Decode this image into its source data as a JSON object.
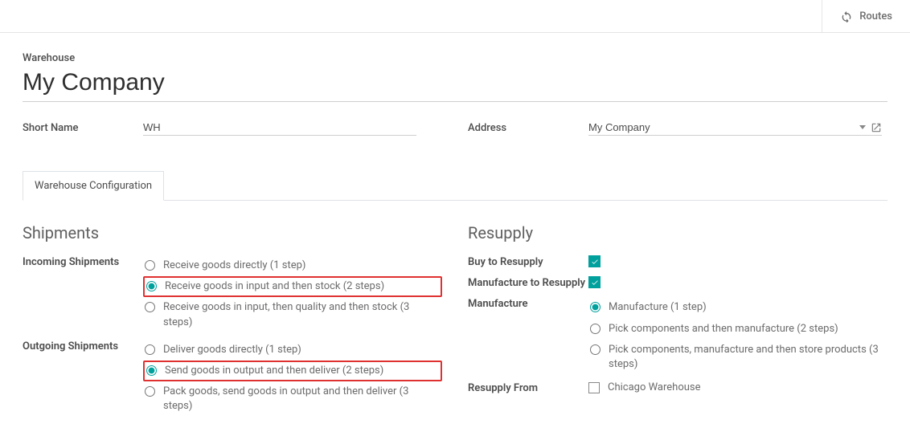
{
  "topbar": {
    "routes": "Routes"
  },
  "labels": {
    "warehouse": "Warehouse",
    "short_name": "Short Name",
    "address": "Address"
  },
  "values": {
    "name": "My Company",
    "short_name": "WH",
    "address": "My Company"
  },
  "tabs": {
    "config": "Warehouse Configuration"
  },
  "left": {
    "title": "Shipments",
    "incoming_label": "Incoming Shipments",
    "outgoing_label": "Outgoing Shipments",
    "incoming": [
      "Receive goods directly (1 step)",
      "Receive goods in input and then stock (2 steps)",
      "Receive goods in input, then quality and then stock (3 steps)"
    ],
    "outgoing": [
      "Deliver goods directly (1 step)",
      "Send goods in output and then deliver (2 steps)",
      "Pack goods, send goods in output and then deliver (3 steps)"
    ]
  },
  "right": {
    "title": "Resupply",
    "buy_label": "Buy to Resupply",
    "mfg_resupply_label": "Manufacture to Resupply",
    "mfg_label": "Manufacture",
    "mfg_options": [
      "Manufacture (1 step)",
      "Pick components and then manufacture (2 steps)",
      "Pick components, manufacture and then store products (3 steps)"
    ],
    "resupply_from_label": "Resupply From",
    "resupply_from_option": "Chicago Warehouse"
  }
}
